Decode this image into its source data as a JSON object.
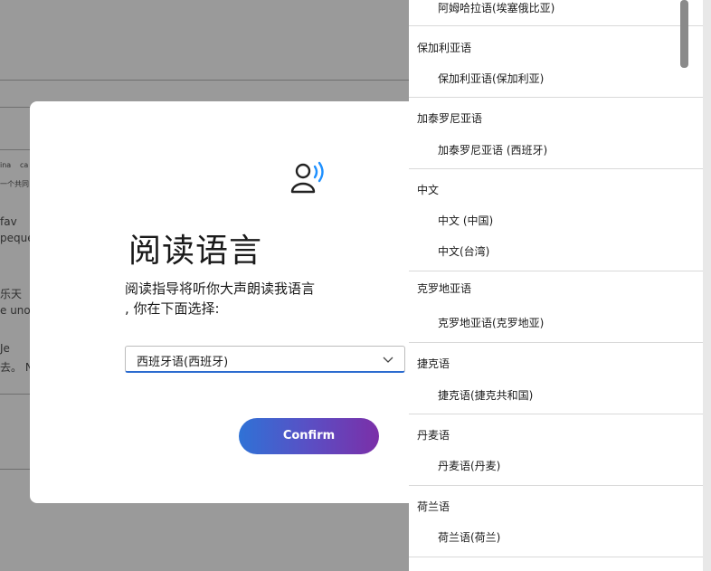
{
  "background_document": {
    "fragments": [
      "ina",
      "ca",
      "一个共同",
      "fav",
      "peque",
      "乐天",
      "e uno",
      "Je",
      "去。 N"
    ]
  },
  "dialog": {
    "icon": "voice-icon",
    "title": "阅读语言",
    "description_line1": "阅读指导将听你大声朗读我语言",
    "description_line2": ", 你在下面选择:",
    "select": {
      "value": "西班牙语(西班牙)",
      "chevron_icon": "chevron-down-icon"
    },
    "confirm_label": "Confirm"
  },
  "dropdown": {
    "items": [
      {
        "type": "option",
        "label": "阿姆哈拉语(埃塞俄比亚)"
      },
      {
        "type": "header",
        "label": "保加利亚语"
      },
      {
        "type": "option",
        "label": "保加利亚语(保加利亚)"
      },
      {
        "type": "header",
        "label": "加泰罗尼亚语"
      },
      {
        "type": "option",
        "label": "加泰罗尼亚语 (西班牙)"
      },
      {
        "type": "header",
        "label": "中文"
      },
      {
        "type": "option",
        "label": "中文 (中国)"
      },
      {
        "type": "option",
        "label": "中文(台湾)"
      },
      {
        "type": "header",
        "label": "克罗地亚语"
      },
      {
        "type": "option",
        "label": "克罗地亚语(克罗地亚)"
      },
      {
        "type": "header",
        "label": "捷克语"
      },
      {
        "type": "option",
        "label": "捷克语(捷克共和国)"
      },
      {
        "type": "header",
        "label": "丹麦语"
      },
      {
        "type": "option",
        "label": "丹麦语(丹麦)"
      },
      {
        "type": "header",
        "label": "荷兰语"
      },
      {
        "type": "option",
        "label": "荷兰语(荷兰)"
      }
    ]
  },
  "colors": {
    "accent": "#2b6bcf",
    "button_gradient": [
      "#2f72d6",
      "#7b2fa8"
    ],
    "overlay": "#808080"
  }
}
